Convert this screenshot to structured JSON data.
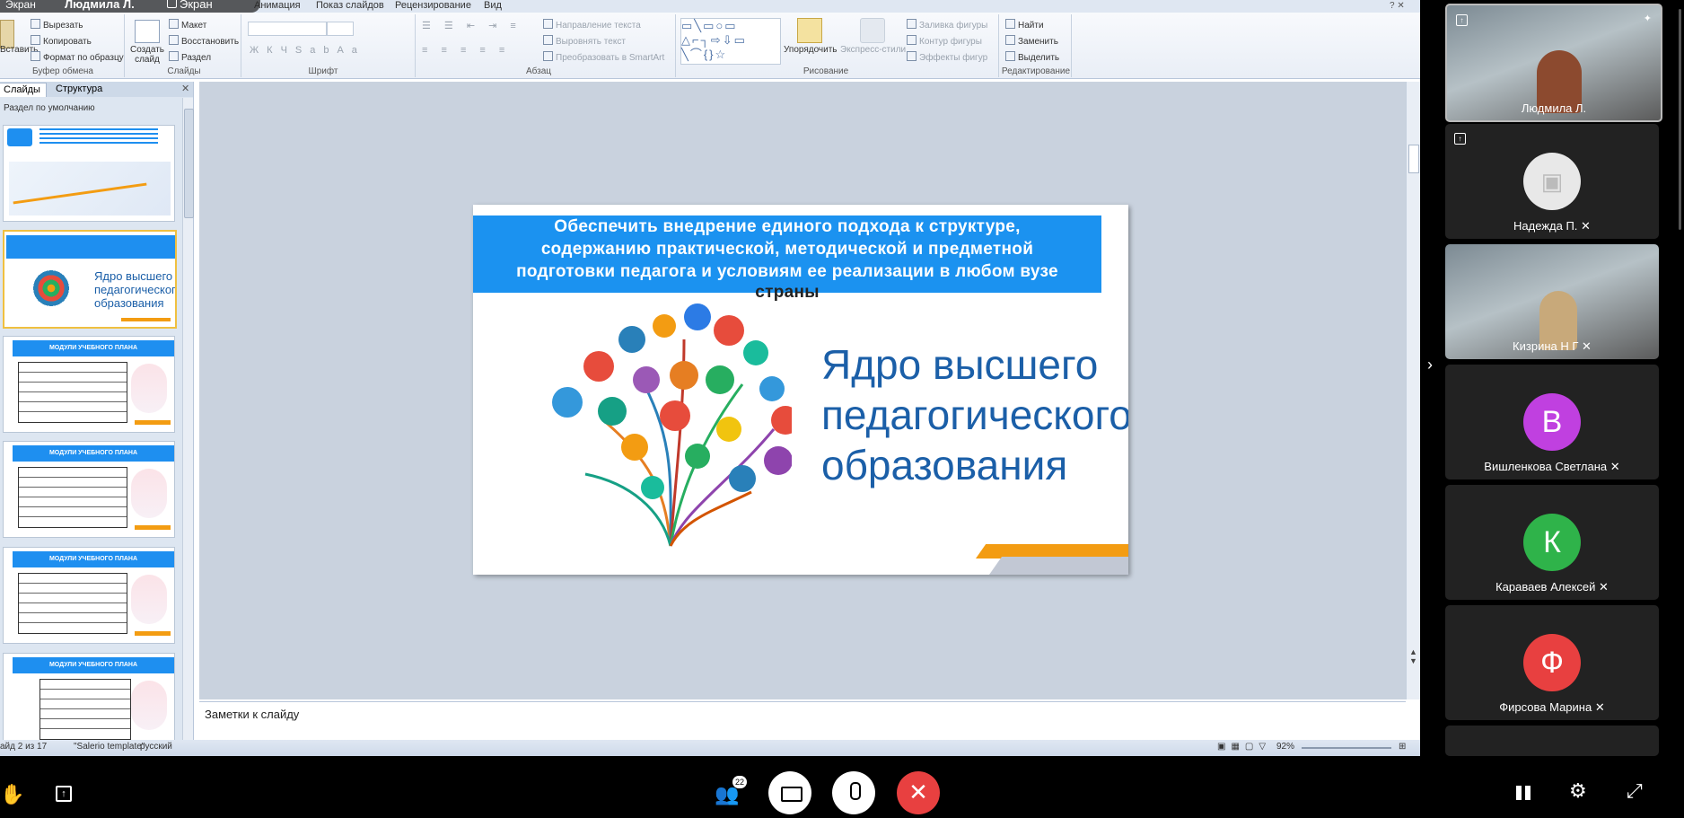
{
  "menu": {
    "tabs": [
      "Анимация",
      "Показ слайдов",
      "Рецензирование",
      "Вид"
    ]
  },
  "overlay": {
    "name": "Людмила Л.",
    "screen_label": "Экран"
  },
  "ribbon": {
    "clipboard": {
      "paste": "Вставить",
      "cut": "Вырезать",
      "copy": "Копировать",
      "format": "Формат по образцу",
      "group": "Буфер обмена"
    },
    "slides": {
      "create": "Создать слайд",
      "layout": "Макет",
      "reset": "Восстановить",
      "section": "Раздел",
      "group": "Слайды"
    },
    "font": {
      "group": "Шрифт"
    },
    "paragraph": {
      "text_direction": "Направление текста",
      "align_text": "Выровнять текст",
      "smartart": "Преобразовать в SmartArt",
      "group": "Абзац"
    },
    "drawing": {
      "arrange": "Упорядочить",
      "express": "Экспресс-стили",
      "fill": "Заливка фигуры",
      "outline": "Контур фигуры",
      "effects": "Эффекты фигур",
      "group": "Рисование"
    },
    "editing": {
      "find": "Найти",
      "replace": "Заменить",
      "select": "Выделить",
      "group": "Редактирование"
    }
  },
  "left_panel": {
    "tab_slides": "Слайды",
    "tab_structure": "Структура",
    "section": "Раздел по умолчанию",
    "thumbs": [
      {
        "header": "",
        "kind": "university"
      },
      {
        "header": "",
        "kind": "core"
      },
      {
        "header": "МОДУЛИ УЧЕБНОГО ПЛАНА",
        "kind": "table"
      },
      {
        "header": "МОДУЛИ УЧЕБНОГО ПЛАНА",
        "kind": "table"
      },
      {
        "header": "МОДУЛИ УЧЕБНОГО ПЛАНА",
        "kind": "table"
      },
      {
        "header": "МОДУЛИ УЧЕБНОГО ПЛАНА",
        "kind": "table"
      }
    ],
    "thumb2_big": "Ядро высшего педагогического образования"
  },
  "slide": {
    "title_lines": [
      "Обеспечить внедрение единого подхода к структуре,",
      "содержанию практической, методической и предметной",
      "подготовки педагога и условиям ее реализации в любом вузе",
      "страны"
    ],
    "big_lines": [
      "Ядро высшего",
      "педагогического",
      "образования"
    ]
  },
  "notes": {
    "placeholder": "Заметки к слайду"
  },
  "status": {
    "slide": "айд 2 из 17",
    "theme": "\"Salerio template\"",
    "lang": "русский",
    "zoom": "92%"
  },
  "participants": [
    {
      "name": "Людмила Л.",
      "kind": "video",
      "avatar": "",
      "color": ""
    },
    {
      "name": "Надежда П.",
      "kind": "camera",
      "avatar": "",
      "color": "#e8e8e8"
    },
    {
      "name": "Кизрина Н Г",
      "kind": "video",
      "avatar": "",
      "color": ""
    },
    {
      "name": "Вишленкова Светлана",
      "kind": "letter",
      "avatar": "В",
      "color": "#c040e0"
    },
    {
      "name": "Караваев Алексей",
      "kind": "letter",
      "avatar": "К",
      "color": "#2fb34a"
    },
    {
      "name": "Фирсова Марина",
      "kind": "letter",
      "avatar": "Ф",
      "color": "#e84040"
    }
  ],
  "controls": {
    "participants_count": "22"
  },
  "colors": {
    "slide_blue": "#1b92f0",
    "slide_text": "#1b5fa8",
    "end_call": "#e84040"
  }
}
